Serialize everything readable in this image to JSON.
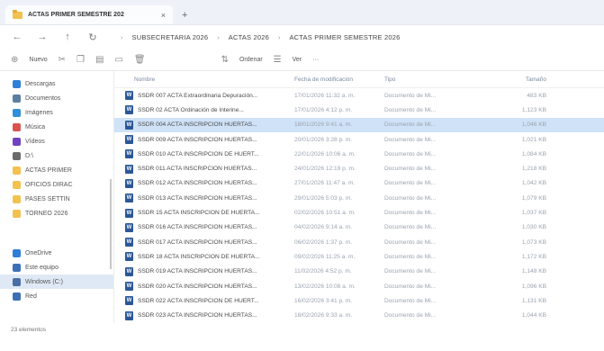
{
  "window": {
    "tab_title": "ACTAS PRIMER SEMESTRE 202",
    "tab_close": "×",
    "tab_add": "+"
  },
  "nav": {
    "back": "←",
    "forward": "→",
    "up": "↑",
    "refresh": "↻",
    "breadcrumb": [
      "SUBSECRETARIA 2026",
      "ACTAS 2026",
      "ACTAS PRIMER SEMESTRE 2026"
    ]
  },
  "toolbar": {
    "new_label": "Nuevo",
    "sort_label": "Ordenar",
    "view_label": "Ver",
    "more_label": "···"
  },
  "columns": {
    "name": "Nombre",
    "date": "Fecha de modificación",
    "type": "Tipo",
    "size": "Tamaño"
  },
  "sidebar": {
    "items": [
      {
        "label": "Descargas",
        "color": "#2f7ed8"
      },
      {
        "label": "Documentos",
        "color": "#5b7fa3"
      },
      {
        "label": "Imágenes",
        "color": "#2f8fd8"
      },
      {
        "label": "Música",
        "color": "#d9534f"
      },
      {
        "label": "Vídeos",
        "color": "#6f42c1"
      },
      {
        "label": "D:\\",
        "color": "#6b6b6b"
      },
      {
        "label": "ACTAS PRIMER",
        "color": "#f2c14e"
      },
      {
        "label": "OFICIOS DIRAC",
        "color": "#f2c14e"
      },
      {
        "label": "PASES SETTIN",
        "color": "#f2c14e"
      },
      {
        "label": "TORNEO 2026",
        "color": "#f2c14e"
      }
    ],
    "lower_items": [
      {
        "label": "OneDrive",
        "color": "#2f7ed8"
      },
      {
        "label": "Este equipo",
        "color": "#3b6fb6"
      },
      {
        "label": "Windows (C:)",
        "color": "#4a6ea8"
      },
      {
        "label": "Red",
        "color": "#3b6fb6"
      }
    ]
  },
  "files": [
    {
      "name": "SSDR 007 ACTA Extraordinaria Depuración...",
      "date": "17/01/2026 11:32 a. m.",
      "type": "Documento de Mi...",
      "size": "483 KB"
    },
    {
      "name": "SSDR 02 ACTA Ordinación de Interine...",
      "date": "17/01/2026 4:12 p. m.",
      "type": "Documento de Mi...",
      "size": "1,123 KB"
    },
    {
      "name": "SSDR 004 ACTA INSCRIPCION HUERTAS...",
      "date": "18/01/2026 9:41 a. m.",
      "type": "Documento de Mi...",
      "size": "1,046 KB"
    },
    {
      "name": "SSDR 009 ACTA INSCRIPCION HUERTAS...",
      "date": "20/01/2026 3:28 p. m.",
      "type": "Documento de Mi...",
      "size": "1,021 KB"
    },
    {
      "name": "SSDR 010 ACTA INSCRIPCION DE HUERT...",
      "date": "22/01/2026 10:06 a. m.",
      "type": "Documento de Mi...",
      "size": "1,084 KB"
    },
    {
      "name": "SSDR 011 ACTA INSCRIPCION HUERTAS...",
      "date": "24/01/2026 12:19 p. m.",
      "type": "Documento de Mi...",
      "size": "1,218 KB"
    },
    {
      "name": "SSDR 012 ACTA INSCRIPCION HUERTAS...",
      "date": "27/01/2026 11:47 a. m.",
      "type": "Documento de Mi...",
      "size": "1,042 KB"
    },
    {
      "name": "SSDR 013 ACTA INSCRIPCION HUERTAS...",
      "date": "29/01/2026 5:03 p. m.",
      "type": "Documento de Mi...",
      "size": "1,079 KB"
    },
    {
      "name": "SSDR 15 ACTA INSCRIPCION DE HUERTA...",
      "date": "02/02/2026 10:51 a. m.",
      "type": "Documento de Mi...",
      "size": "1,037 KB"
    },
    {
      "name": "SSDR 016 ACTA INSCRIPCION HUERTAS...",
      "date": "04/02/2026 9:14 a. m.",
      "type": "Documento de Mi...",
      "size": "1,030 KB"
    },
    {
      "name": "SSDR 017 ACTA INSCRIPCION HUERTAS...",
      "date": "06/02/2026 1:37 p. m.",
      "type": "Documento de Mi...",
      "size": "1,073 KB"
    },
    {
      "name": "SSDR 18 ACTA INSCRIPCION DE HUERTA...",
      "date": "09/02/2026 11:25 a. m.",
      "type": "Documento de Mi...",
      "size": "1,172 KB"
    },
    {
      "name": "SSDR 019 ACTA INSCRIPCION HUERTAS...",
      "date": "11/02/2026 4:52 p. m.",
      "type": "Documento de Mi...",
      "size": "1,148 KB"
    },
    {
      "name": "SSDR 020 ACTA INSCRIPCION HUERTAS...",
      "date": "13/02/2026 10:08 a. m.",
      "type": "Documento de Mi...",
      "size": "1,096 KB"
    },
    {
      "name": "SSDR 022 ACTA INSCRIPCION DE HUERT...",
      "date": "16/02/2026 3:41 p. m.",
      "type": "Documento de Mi...",
      "size": "1,131 KB"
    },
    {
      "name": "SSDR 023 ACTA INSCRIPCION HUERTAS...",
      "date": "18/02/2026 9:33 a. m.",
      "type": "Documento de Mi...",
      "size": "1,044 KB"
    }
  ],
  "selected_index": 2,
  "status": {
    "items_count": "23 elementos"
  }
}
